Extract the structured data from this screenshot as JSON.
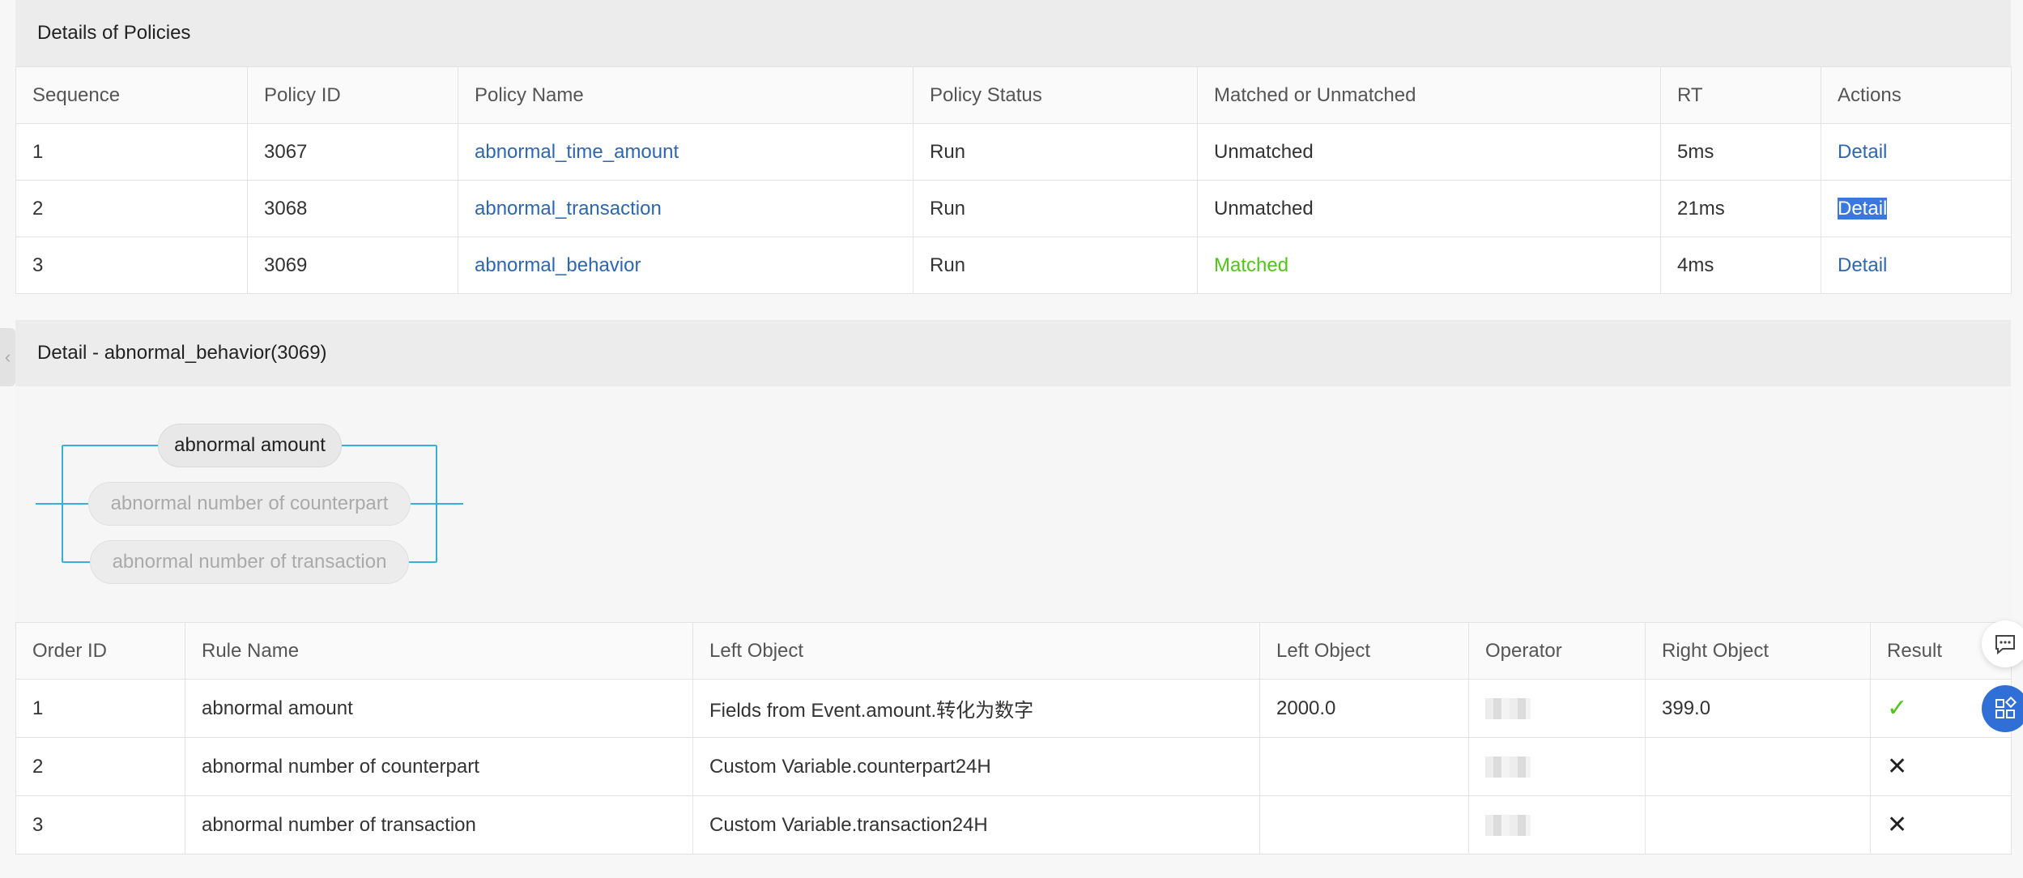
{
  "policies": {
    "title": "Details of Policies",
    "columns": [
      "Sequence",
      "Policy ID",
      "Policy Name",
      "Policy Status",
      "Matched or Unmatched",
      "RT",
      "Actions"
    ],
    "rows": [
      {
        "sequence": "1",
        "policy_id": "3067",
        "policy_name": "abnormal_time_amount",
        "status": "Run",
        "match": "Unmatched",
        "rt": "5ms",
        "action": "Detail"
      },
      {
        "sequence": "2",
        "policy_id": "3068",
        "policy_name": "abnormal_transaction",
        "status": "Run",
        "match": "Unmatched",
        "rt": "21ms",
        "action": "Detail"
      },
      {
        "sequence": "3",
        "policy_id": "3069",
        "policy_name": "abnormal_behavior",
        "status": "Run",
        "match": "Matched",
        "rt": "4ms",
        "action": "Detail"
      }
    ]
  },
  "detail": {
    "title": "Detail - abnormal_behavior(3069)",
    "diagram_nodes": [
      {
        "label": "abnormal amount",
        "state": "active"
      },
      {
        "label": "abnormal number of counterpart",
        "state": "inactive"
      },
      {
        "label": "abnormal number of transaction",
        "state": "inactive"
      }
    ],
    "columns": [
      "Order ID",
      "Rule Name",
      "Left Object",
      "Left Object",
      "Operator",
      "Right Object",
      "Result"
    ],
    "rows": [
      {
        "order_id": "1",
        "rule_name": "abnormal amount",
        "left_object": "Fields from Event.amount.转化为数字",
        "left_value": "2000.0",
        "right_object": "399.0",
        "result": "check"
      },
      {
        "order_id": "2",
        "rule_name": "abnormal number of counterpart",
        "left_object": "Custom Variable.counterpart24H",
        "left_value": "",
        "right_object": "",
        "result": "cross"
      },
      {
        "order_id": "3",
        "rule_name": "abnormal number of transaction",
        "left_object": "Custom Variable.transaction24H",
        "left_value": "",
        "right_object": "",
        "result": "cross"
      }
    ]
  },
  "icons": {
    "collapse": "chevron-left-icon",
    "chat": "chat-icon",
    "apps": "apps-icon",
    "result_pass": "checkmark-icon",
    "result_fail": "cross-icon"
  },
  "colors": {
    "link": "#2f66b0",
    "matched": "#52c41a",
    "connector": "#3ab0d6",
    "apps_button": "#2f6fd6"
  }
}
